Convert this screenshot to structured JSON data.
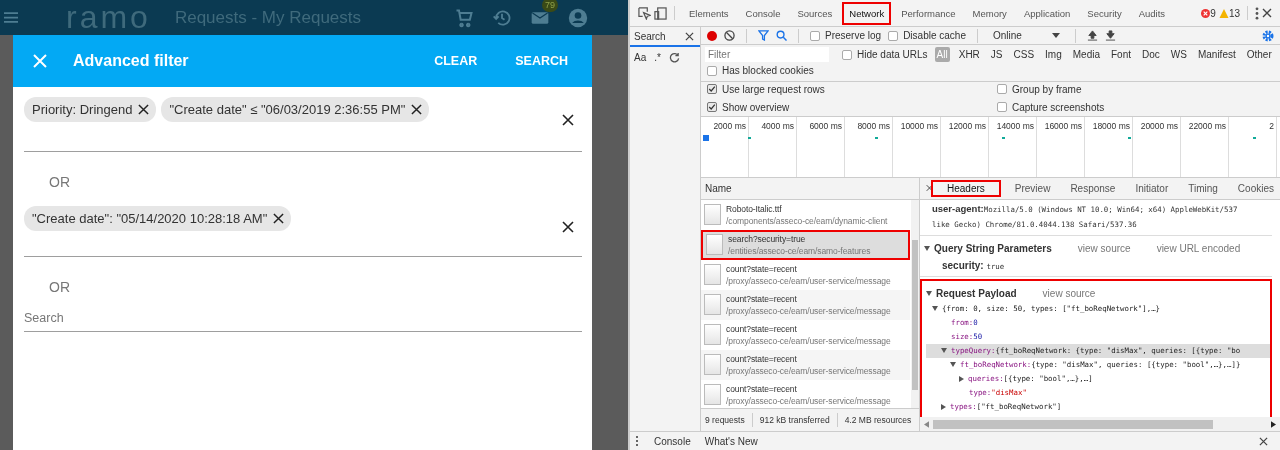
{
  "app": {
    "logo": "ramo",
    "title": "Requests - My Requests",
    "badge": "79"
  },
  "dialog": {
    "title": "Advanced filter",
    "actions": [
      "CLEAR",
      "SEARCH"
    ],
    "rows": [
      {
        "kind": "chips",
        "chips": [
          "Priority: Dringend",
          "\"Create date\" ≤ \"06/03/2019 2:36:55 PM\""
        ]
      },
      {
        "kind": "or",
        "label": "OR"
      },
      {
        "kind": "chips",
        "chips": [
          "\"Create date\": \"05/14/2020 10:28:18 AM\""
        ]
      },
      {
        "kind": "or",
        "label": "OR"
      },
      {
        "kind": "search",
        "placeholder": "Search"
      }
    ]
  },
  "devtools": {
    "tabs": [
      {
        "label": "Elements",
        "selected": false,
        "highlighted": false
      },
      {
        "label": "Console",
        "selected": false,
        "highlighted": false
      },
      {
        "label": "Sources",
        "selected": false,
        "highlighted": false
      },
      {
        "label": "Network",
        "selected": true,
        "highlighted": true
      },
      {
        "label": "Performance",
        "selected": false,
        "highlighted": false
      },
      {
        "label": "Memory",
        "selected": false,
        "highlighted": false
      },
      {
        "label": "Application",
        "selected": false,
        "highlighted": false
      },
      {
        "label": "Security",
        "selected": false,
        "highlighted": false
      },
      {
        "label": "Audits",
        "selected": false,
        "highlighted": false
      }
    ],
    "errors": "9",
    "warnings": "13",
    "search_panel": {
      "title": "Search",
      "options": [
        "Aa",
        ".*"
      ]
    },
    "toolbar_checks": [
      {
        "label": "Preserve log",
        "checked": false
      },
      {
        "label": "Disable cache",
        "checked": false
      }
    ],
    "throttling": "Online",
    "filter": {
      "placeholder": "Filter"
    },
    "hide_data_urls": {
      "label": "Hide data URLs",
      "checked": false
    },
    "types": [
      {
        "label": "All",
        "selected": true
      },
      {
        "label": "XHR",
        "selected": false
      },
      {
        "label": "JS",
        "selected": false
      },
      {
        "label": "CSS",
        "selected": false
      },
      {
        "label": "Img",
        "selected": false
      },
      {
        "label": "Media",
        "selected": false
      },
      {
        "label": "Font",
        "selected": false
      },
      {
        "label": "Doc",
        "selected": false
      },
      {
        "label": "WS",
        "selected": false
      },
      {
        "label": "Manifest",
        "selected": false
      },
      {
        "label": "Other",
        "selected": false
      }
    ],
    "blocked_cookies": {
      "label": "Has blocked cookies",
      "checked": false
    },
    "settings": [
      {
        "label": "Use large request rows",
        "checked": true
      },
      {
        "label": "Group by frame",
        "checked": false
      },
      {
        "label": "Show overview",
        "checked": true
      },
      {
        "label": "Capture screenshots",
        "checked": false
      }
    ],
    "timeline_ticks": [
      "2000 ms",
      "4000 ms",
      "6000 ms",
      "8000 ms",
      "10000 ms",
      "12000 ms",
      "14000 ms",
      "16000 ms",
      "18000 ms",
      "20000 ms",
      "22000 ms",
      "2"
    ],
    "name_header": "Name",
    "requests": [
      {
        "name": "Roboto-Italic.ttf",
        "path": "/components/asseco-ce/eam/dynamic-client",
        "selected": false,
        "highlighted": false
      },
      {
        "name": "search?security=true",
        "path": "/entities/asseco-ce/eam/samo-features",
        "selected": true,
        "highlighted": true
      },
      {
        "name": "count?state=recent",
        "path": "/proxy/asseco-ce/eam/user-service/message",
        "selected": false,
        "highlighted": false
      },
      {
        "name": "count?state=recent",
        "path": "/proxy/asseco-ce/eam/user-service/message",
        "selected": false,
        "highlighted": false
      },
      {
        "name": "count?state=recent",
        "path": "/proxy/asseco-ce/eam/user-service/message",
        "selected": false,
        "highlighted": false
      },
      {
        "name": "count?state=recent",
        "path": "/proxy/asseco-ce/eam/user-service/message",
        "selected": false,
        "highlighted": false
      },
      {
        "name": "count?state=recent",
        "path": "/proxy/asseco-ce/eam/user-service/message",
        "selected": false,
        "highlighted": false
      }
    ],
    "summary": [
      "9 requests",
      "912 kB transferred",
      "4.2 MB resources"
    ],
    "detail_tabs": [
      {
        "label": "Headers",
        "selected": true,
        "highlighted": true
      },
      {
        "label": "Preview",
        "selected": false,
        "highlighted": false
      },
      {
        "label": "Response",
        "selected": false,
        "highlighted": false
      },
      {
        "label": "Initiator",
        "selected": false,
        "highlighted": false
      },
      {
        "label": "Timing",
        "selected": false,
        "highlighted": false
      },
      {
        "label": "Cookies",
        "selected": false,
        "highlighted": false
      }
    ],
    "user_agent": {
      "key": "user-agent:",
      "lines": [
        "Mozilla/5.0 (Windows NT 10.0; Win64; x64) AppleWebKit/537",
        "like Gecko) Chrome/81.0.4044.138 Safari/537.36"
      ]
    },
    "query": {
      "title": "Query String Parameters",
      "expanded": true,
      "links": [
        "view source",
        "view URL encoded"
      ],
      "params": [
        {
          "key": "security:",
          "value": "true"
        }
      ]
    },
    "payload": {
      "title": "Request Payload",
      "expanded": true,
      "highlighted": true,
      "links": [
        "view source"
      ],
      "tree": [
        {
          "text": "{from: 0, size: 50, types: [\"ft_boReqNetwork\"],…}",
          "expanded": true,
          "selected": false,
          "children": [
            {
              "key": "from:",
              "value": "0",
              "kind": "number",
              "selected": false
            },
            {
              "key": "size:",
              "value": "50",
              "kind": "number",
              "selected": false
            },
            {
              "key": "typeQuery:",
              "value": "{ft_boReqNetwork: {type: \"disMax\", queries: [{type: \"bo",
              "expanded": true,
              "selected": true,
              "children": [
                {
                  "key": "ft_boReqNetwork:",
                  "value": "{type: \"disMax\", queries: [{type: \"bool\",…},…]}",
                  "expanded": true,
                  "selected": false,
                  "children": [
                    {
                      "key": "queries:",
                      "value": "[{type: \"bool\",…},…]",
                      "expanded": false,
                      "selected": false
                    },
                    {
                      "key": "type:",
                      "value": "\"disMax\"",
                      "kind": "string",
                      "selected": false
                    }
                  ]
                }
              ]
            },
            {
              "key": "types:",
              "value": "[\"ft_boReqNetwork\"]",
              "expanded": false,
              "selected": false
            }
          ]
        }
      ]
    },
    "drawer_tabs": [
      "Console",
      "What's New"
    ]
  }
}
